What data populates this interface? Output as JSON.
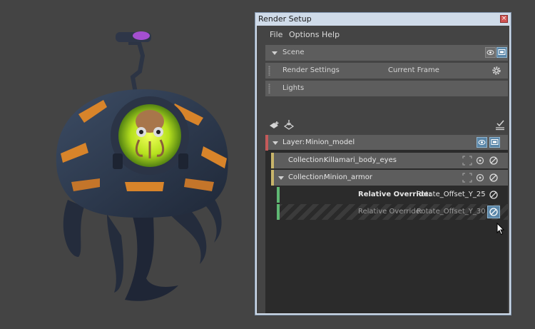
{
  "window": {
    "title": "Render Setup",
    "close_glyph": "×"
  },
  "menu": [
    "File",
    "Options",
    "Help"
  ],
  "scene": {
    "label": "Scene"
  },
  "render_settings": {
    "label": "Render Settings",
    "value": "Current Frame"
  },
  "lights": {
    "label": "Lights"
  },
  "layer": {
    "prefix": "Layer:",
    "name": "Minion_model",
    "color": "#c45a5a"
  },
  "collections": [
    {
      "prefix": "Collection:",
      "name": "Killamari_body_eyes",
      "color": "#c8b46a"
    },
    {
      "prefix": "Collection:",
      "name": "Minion_armor",
      "color": "#c8b46a"
    }
  ],
  "overrides": [
    {
      "prefix": "Relative Override:",
      "name": "Rotate_Offset_Y_25",
      "color": "#5fb873"
    },
    {
      "prefix": "Relative Override:",
      "name": "Rotate_Offset_Y_30",
      "color": "#5fb873"
    }
  ],
  "icons": {
    "visibility": "eye-icon",
    "renderable": "monitor-icon",
    "settings": "gear-icon",
    "isolate": "isolate-select-icon",
    "disable": "disable-circle-icon",
    "add_layer": "add-layer-icon",
    "import": "import-icon",
    "batch": "batch-render-icon",
    "cursor": "mouse-cursor"
  }
}
